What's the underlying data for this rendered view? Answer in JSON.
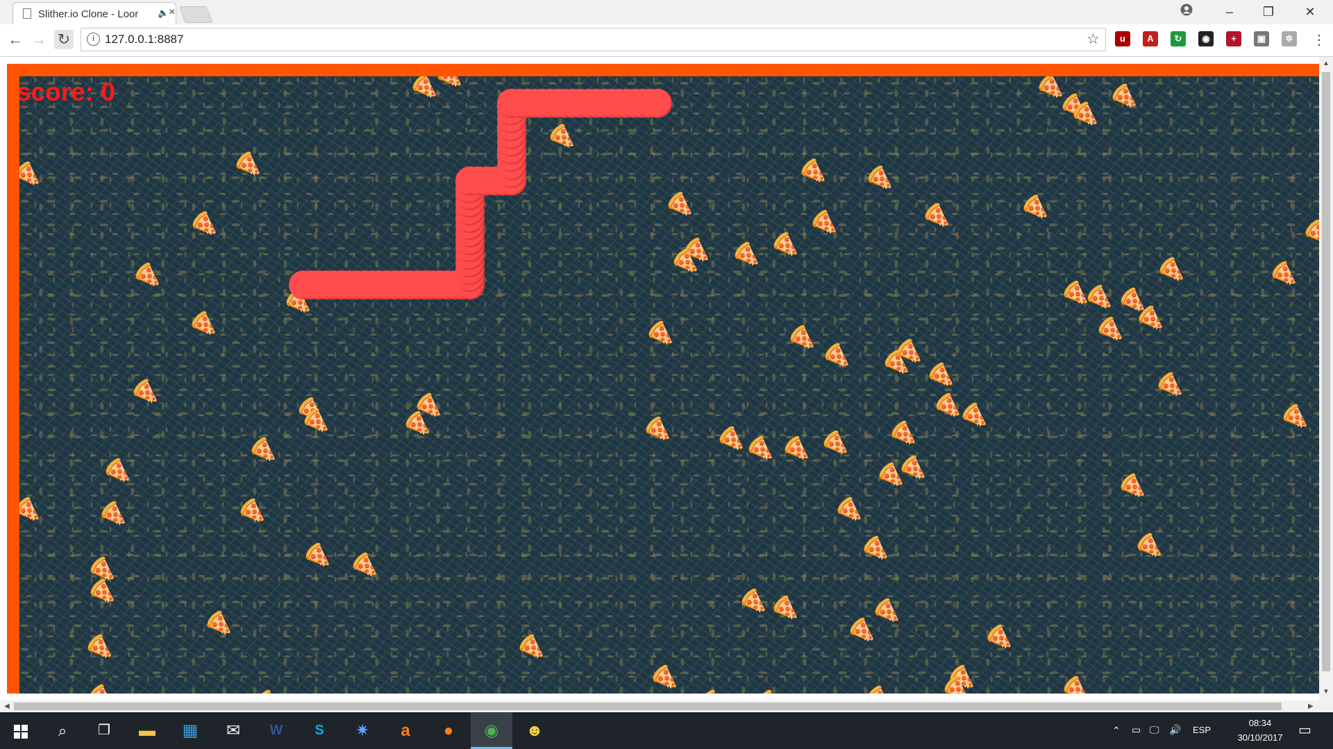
{
  "browser": {
    "tab_title": "Slither.io Clone - Loor",
    "tab_audio_icon": "speaker-icon",
    "url": "127.0.0.1:8887",
    "window_buttons": [
      "profile",
      "minimize",
      "restore",
      "close"
    ]
  },
  "game": {
    "score_label": "score: 0",
    "snake_color": "#ff4d4d",
    "border_color": "#ff5500",
    "background_color": "#1d3747",
    "food_icon": "pizza-slice"
  },
  "taskbar": {
    "language": "ESP",
    "time": "08:34",
    "date": "30/10/2017"
  }
}
